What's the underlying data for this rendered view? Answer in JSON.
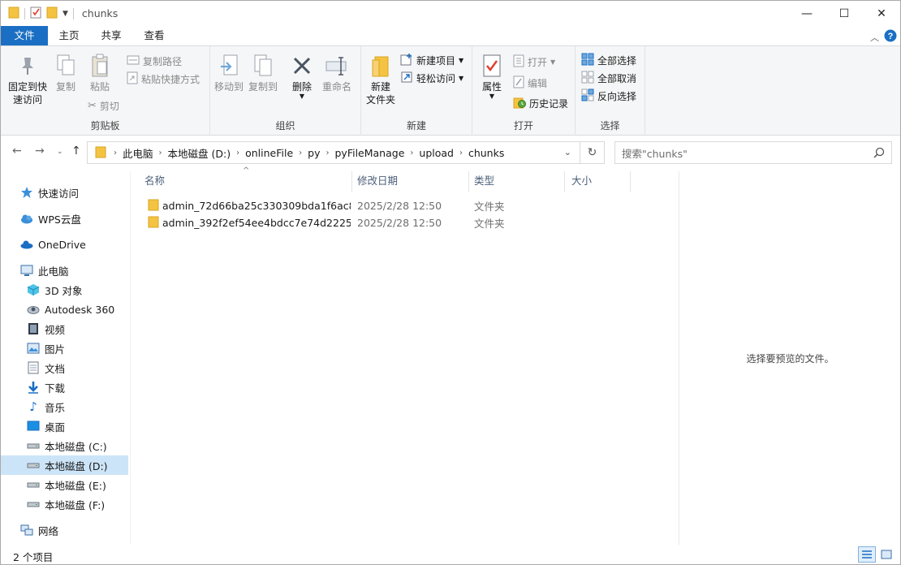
{
  "window": {
    "title": "chunks",
    "controls": [
      "—",
      "☐",
      "✕"
    ]
  },
  "ribbon_tabs": [
    "文件",
    "主页",
    "共享",
    "查看"
  ],
  "ribbon": {
    "clipboard": {
      "group_label": "剪贴板",
      "pin": "固定到快\n速访问",
      "copy": "复制",
      "paste": "粘贴",
      "copy_path": "复制路径",
      "paste_shortcut": "粘贴快捷方式",
      "cut": "剪切"
    },
    "organize": {
      "group_label": "组织",
      "move_to": "移动到",
      "copy_to": "复制到",
      "delete": "删除",
      "rename": "重命名"
    },
    "new": {
      "group_label": "新建",
      "new_folder": "新建\n文件夹",
      "new_item": "新建项目",
      "easy_access": "轻松访问"
    },
    "open": {
      "group_label": "打开",
      "properties": "属性",
      "open": "打开",
      "edit": "编辑",
      "history": "历史记录"
    },
    "select": {
      "group_label": "选择",
      "select_all": "全部选择",
      "select_none": "全部取消",
      "invert": "反向选择"
    }
  },
  "address": {
    "segments": [
      "此电脑",
      "本地磁盘 (D:)",
      "onlineFile",
      "py",
      "pyFileManage",
      "upload",
      "chunks"
    ],
    "search_placeholder": "搜索\"chunks\""
  },
  "nav": {
    "items": [
      {
        "label": "快速访问",
        "icon": "star-icon"
      },
      {
        "label": "WPS云盘",
        "icon": "cloud-icon"
      },
      {
        "label": "OneDrive",
        "icon": "onedrive-icon"
      },
      {
        "label": "此电脑",
        "icon": "computer-icon"
      },
      {
        "label": "3D 对象",
        "icon": "cube-icon"
      },
      {
        "label": "Autodesk 360",
        "icon": "autodesk-icon"
      },
      {
        "label": "视频",
        "icon": "video-icon"
      },
      {
        "label": "图片",
        "icon": "picture-icon"
      },
      {
        "label": "文档",
        "icon": "document-icon"
      },
      {
        "label": "下载",
        "icon": "download-icon"
      },
      {
        "label": "音乐",
        "icon": "music-icon"
      },
      {
        "label": "桌面",
        "icon": "desktop-icon"
      },
      {
        "label": "本地磁盘 (C:)",
        "icon": "drive-icon"
      },
      {
        "label": "本地磁盘 (D:)",
        "icon": "drive-icon"
      },
      {
        "label": "本地磁盘 (E:)",
        "icon": "drive-icon"
      },
      {
        "label": "本地磁盘 (F:)",
        "icon": "drive-icon"
      },
      {
        "label": "网络",
        "icon": "network-icon"
      }
    ]
  },
  "columns": {
    "name": "名称",
    "date": "修改日期",
    "type": "类型",
    "size": "大小"
  },
  "files": [
    {
      "name": "admin_72d66ba25c330309bda1f6ac8...",
      "date": "2025/2/28 12:50",
      "type": "文件夹"
    },
    {
      "name": "admin_392f2ef54ee4bdcc7e74d2225...",
      "date": "2025/2/28 12:50",
      "type": "文件夹"
    }
  ],
  "preview_text": "选择要预览的文件。",
  "status": {
    "count": "2 个项目"
  },
  "colors": {
    "accent": "#1a6fc4",
    "selection": "#cce4f7",
    "folder": "#f5c342"
  }
}
